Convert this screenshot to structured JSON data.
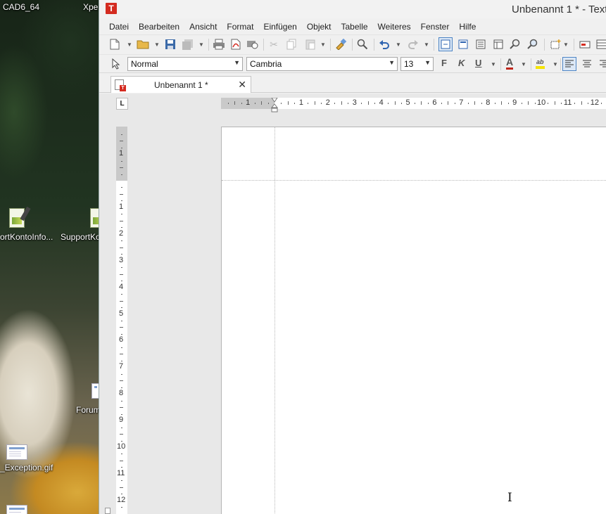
{
  "desktop": {
    "top_labels": [
      "CAD6_64",
      "Xpe"
    ],
    "icons": [
      {
        "label": "ortKontoInfo...",
        "icon": "excel-shortcut-icon"
      },
      {
        "label": "SupportKo",
        "icon": "excel-shortcut-icon"
      },
      {
        "label": "Forum",
        "icon": "document-icon"
      },
      {
        "label": "_Exception.gif",
        "icon": "gif-image-icon"
      }
    ]
  },
  "window": {
    "title": "Unbenannt 1 * - Text",
    "app_logo": "T"
  },
  "menu": [
    "Datei",
    "Bearbeiten",
    "Ansicht",
    "Format",
    "Einfügen",
    "Objekt",
    "Tabelle",
    "Weiteres",
    "Fenster",
    "Hilfe"
  ],
  "format_toolbar": {
    "style_value": "Normal",
    "font_value": "Cambria",
    "size_value": "13",
    "bold_label": "F",
    "italic_label": "K",
    "underline_label": "U",
    "font_color_label": "A",
    "highlight_label": "ab",
    "font_color": "#c0261c",
    "highlight_color": "#f5e400"
  },
  "document_tab": {
    "title": "Unbenannt 1 *",
    "close": "✕"
  },
  "ruler": {
    "tab_stop_symbol": "L",
    "horizontal_numbers": [
      "1",
      "1",
      "2",
      "3",
      "4",
      "5",
      "6",
      "7",
      "8",
      "9",
      "10",
      "11",
      "12"
    ],
    "vertical_numbers": [
      "1",
      "1",
      "2",
      "3",
      "4",
      "5",
      "6",
      "7",
      "8",
      "9",
      "10",
      "11",
      "12"
    ]
  },
  "colors": {
    "accent": "#4d84c4",
    "brand": "#d42b20"
  }
}
